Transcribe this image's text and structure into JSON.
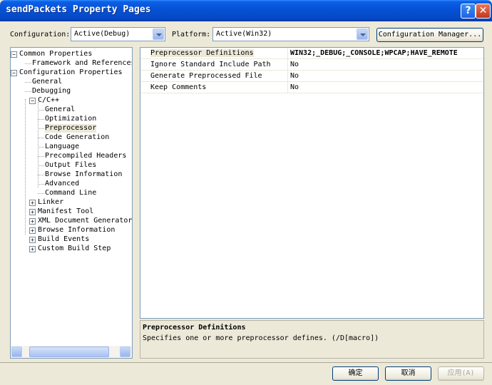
{
  "window": {
    "title": "sendPackets Property Pages",
    "help_glyph": "?",
    "close_glyph": "✕"
  },
  "toolbar": {
    "configuration_label": "Configuration:",
    "configuration_value": "Active(Debug)",
    "platform_label": "Platform:",
    "platform_value": "Active(Win32)",
    "config_manager_button": "Configuration Manager..."
  },
  "tree": {
    "items": [
      {
        "label": "Common Properties",
        "level": 0,
        "expander": "−"
      },
      {
        "label": "Framework and References",
        "level": 1,
        "expander": ""
      },
      {
        "label": "Configuration Properties",
        "level": 0,
        "expander": "−"
      },
      {
        "label": "General",
        "level": 1,
        "expander": ""
      },
      {
        "label": "Debugging",
        "level": 1,
        "expander": ""
      },
      {
        "label": "C/C++",
        "level": 1,
        "expander": "−"
      },
      {
        "label": "General",
        "level": 2,
        "expander": ""
      },
      {
        "label": "Optimization",
        "level": 2,
        "expander": ""
      },
      {
        "label": "Preprocessor",
        "level": 2,
        "expander": "",
        "selected": true
      },
      {
        "label": "Code Generation",
        "level": 2,
        "expander": ""
      },
      {
        "label": "Language",
        "level": 2,
        "expander": ""
      },
      {
        "label": "Precompiled Headers",
        "level": 2,
        "expander": ""
      },
      {
        "label": "Output Files",
        "level": 2,
        "expander": ""
      },
      {
        "label": "Browse Information",
        "level": 2,
        "expander": ""
      },
      {
        "label": "Advanced",
        "level": 2,
        "expander": ""
      },
      {
        "label": "Command Line",
        "level": 2,
        "expander": ""
      },
      {
        "label": "Linker",
        "level": 1,
        "expander": "+"
      },
      {
        "label": "Manifest Tool",
        "level": 1,
        "expander": "+"
      },
      {
        "label": "XML Document Generator",
        "level": 1,
        "expander": "+"
      },
      {
        "label": "Browse Information",
        "level": 1,
        "expander": "+"
      },
      {
        "label": "Build Events",
        "level": 1,
        "expander": "+"
      },
      {
        "label": "Custom Build Step",
        "level": 1,
        "expander": "+"
      }
    ]
  },
  "properties": {
    "rows": [
      {
        "name": "Preprocessor Definitions",
        "value": "WIN32;_DEBUG;_CONSOLE;WPCAP;HAVE_REMOTE",
        "selected": true
      },
      {
        "name": "Ignore Standard Include Path",
        "value": "No"
      },
      {
        "name": "Generate Preprocessed File",
        "value": "No"
      },
      {
        "name": "Keep Comments",
        "value": "No"
      }
    ]
  },
  "description": {
    "title": "Preprocessor Definitions",
    "text": "Specifies one or more preprocessor defines.     (/D[macro])"
  },
  "buttons": {
    "ok": "确定",
    "cancel": "取消",
    "apply": "应用(A)"
  },
  "scrollbar": {
    "left_glyph": "◀",
    "right_glyph": "▶"
  }
}
